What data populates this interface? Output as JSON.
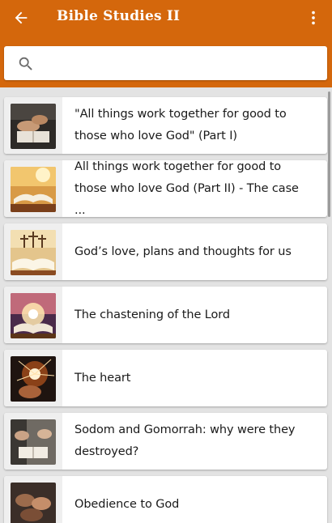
{
  "app": {
    "title": "Bible Studies II",
    "accent_color": "#d4670c",
    "back_icon": "arrow-back-icon",
    "menu_icon": "more-vert-icon"
  },
  "search": {
    "icon": "search-icon",
    "value": "",
    "placeholder": ""
  },
  "list": {
    "items": [
      {
        "title": "\"All things work together for good to those who love God\" (Part I)",
        "thumb": "hands-bible-image"
      },
      {
        "title": "All things work together for good to those who love God (Part II) - The case ...",
        "thumb": "open-book-light-image"
      },
      {
        "title": "God’s love, plans and thoughts for us",
        "thumb": "three-crosses-image"
      },
      {
        "title": "The chastening of the Lord",
        "thumb": "glowing-bible-image"
      },
      {
        "title": "The heart",
        "thumb": "praying-hands-light-image"
      },
      {
        "title": "Sodom and Gomorrah: why were they destroyed?",
        "thumb": "group-bible-study-image"
      },
      {
        "title": "Obedience to God",
        "thumb": "joined-hands-image"
      }
    ]
  }
}
